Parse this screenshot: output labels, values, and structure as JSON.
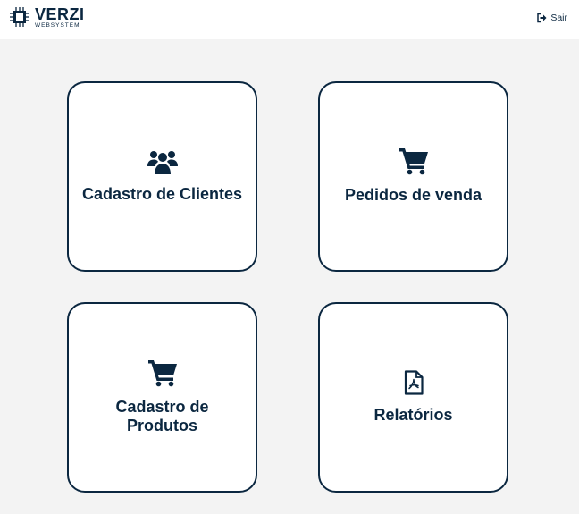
{
  "header": {
    "logo_title": "VERZI",
    "logo_subtitle": "WEBSYSTEM",
    "logout_label": "Sair"
  },
  "cards": [
    {
      "label": "Cadastro de Clientes",
      "icon": "users-icon"
    },
    {
      "label": "Pedidos de venda",
      "icon": "shopping-cart-icon"
    },
    {
      "label": "Cadastro de Produtos",
      "icon": "shopping-cart-icon"
    },
    {
      "label": "Relatórios",
      "icon": "pdf-file-icon"
    }
  ],
  "colors": {
    "primary": "#0b2740",
    "background": "#f3f3f3",
    "surface": "#ffffff"
  }
}
